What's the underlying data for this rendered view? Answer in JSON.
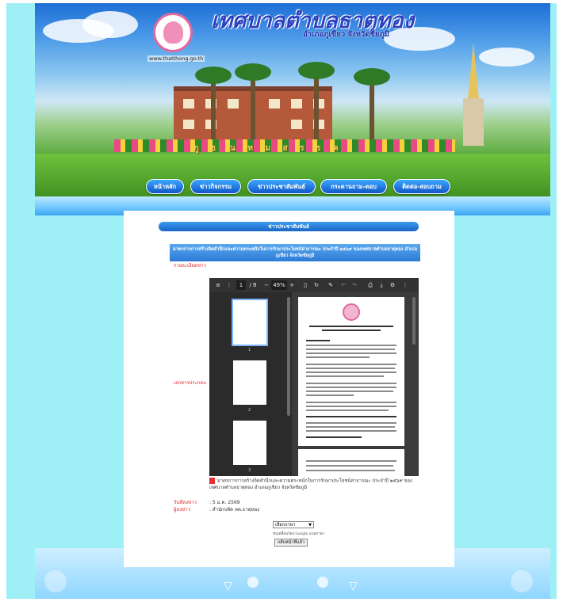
{
  "site": {
    "title": "เทศบาลตำบลธาตุทอง",
    "subtitle": "อำเภอภูเขียว จังหวัดชัยภูมิ",
    "url": "www.thatthong.go.th",
    "banner_text": "ภู ธ ณ ท ม ส ร ร ค"
  },
  "nav": {
    "items": [
      {
        "label": "หน้าหลัก"
      },
      {
        "label": "ข่าวกิจกรรม"
      },
      {
        "label": "ข่าวประชาสัมพันธ์"
      },
      {
        "label": "กระดานถาม-ตอบ"
      },
      {
        "label": "ติดต่อ-สอบถาม"
      }
    ]
  },
  "content": {
    "section_title": "ข่าวประชาสัมพันธ์",
    "news_title": "มาตรการการสร้างจิตสำนึกและความตระหนักในการรักษาประโยชน์สาธารณะ ประจำปี ๒๕๖๙ ของเทศบาลตำบลธาตุทอง อำเภอภูเขียว จังหวัดชัยภูมิ",
    "detail_label": "รายละเอียดข่าว",
    "attachment_label": "เอกสารประกอบ",
    "attachment_name": "มาตรการการสร้างจิตสำนึกและความตระหนักในการรักษาประโยชน์สาธารณะ ประจำปี ๒๕๖๙ ของเทศบาลตำบลธาตุทอง อำเภอภูเขียว จังหวัดชัยภูมิ",
    "date_label": "วันที่ลงข่าว",
    "date_value": ": 5 ม.ค. 2569",
    "poster_label": "ผู้ลงข่าว",
    "poster_value": ": สำนักปลัด ทต.ธาตุทอง",
    "select_value": "เลือกภาษา",
    "powered_text": "ขับเคลื่อนโดย Google แปลภาษา",
    "back_button": "กลับหน้าที่แล้ว"
  },
  "pdf_viewer": {
    "page_current": "1",
    "page_total": "/ 8",
    "zoom": "49%",
    "thumb_numbers": [
      "1",
      "2",
      "3"
    ],
    "icons": [
      "menu-icon",
      "sidebar-icon",
      "zoom-out-icon",
      "zoom-in-icon",
      "fit-page-icon",
      "rotate-icon",
      "draw-icon",
      "undo-icon",
      "redo-icon",
      "print-icon",
      "download-icon",
      "more-icon"
    ]
  }
}
